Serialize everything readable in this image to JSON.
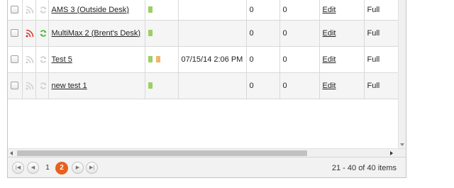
{
  "colors": {
    "status_green": "#9ccf66",
    "status_orange": "#f4b468",
    "rss_active": "#d9342b",
    "sync_active": "#3fba2c",
    "icon_inactive": "#cfcfcf",
    "current_page": "#e8601c"
  },
  "rows": [
    {
      "name": "AMS 3 (Outside Desk)",
      "rss_icon": "rss-icon",
      "rss_active": false,
      "sync_icon": "sync-icon",
      "sync_active": false,
      "status": [
        "green"
      ],
      "date": "",
      "a": "0",
      "b": "0",
      "edit": "Edit",
      "mode": "Full"
    },
    {
      "name": "MultiMax 2 (Brent's Desk)",
      "rss_icon": "rss-icon",
      "rss_active": true,
      "sync_icon": "sync-icon",
      "sync_active": true,
      "status": [
        "green"
      ],
      "date": "",
      "a": "0",
      "b": "0",
      "edit": "Edit",
      "mode": "Full"
    },
    {
      "name": "Test 5",
      "rss_icon": "rss-icon",
      "rss_active": false,
      "sync_icon": "sync-icon",
      "sync_active": false,
      "status": [
        "green",
        "orange"
      ],
      "date": "07/15/14 2:06 PM",
      "a": "0",
      "b": "0",
      "edit": "Edit",
      "mode": "Full"
    },
    {
      "name": "new test 1",
      "rss_icon": "rss-icon",
      "rss_active": false,
      "sync_icon": "sync-icon",
      "sync_active": false,
      "status": [
        "green"
      ],
      "date": "",
      "a": "0",
      "b": "0",
      "edit": "Edit",
      "mode": "Full"
    }
  ],
  "pager": {
    "first_icon": "first-page-icon",
    "prev_icon": "prev-page-icon",
    "next_icon": "next-page-icon",
    "last_icon": "last-page-icon",
    "pages": [
      "1",
      "2"
    ],
    "current_page": "2",
    "info": "21 - 40 of 40 items"
  }
}
